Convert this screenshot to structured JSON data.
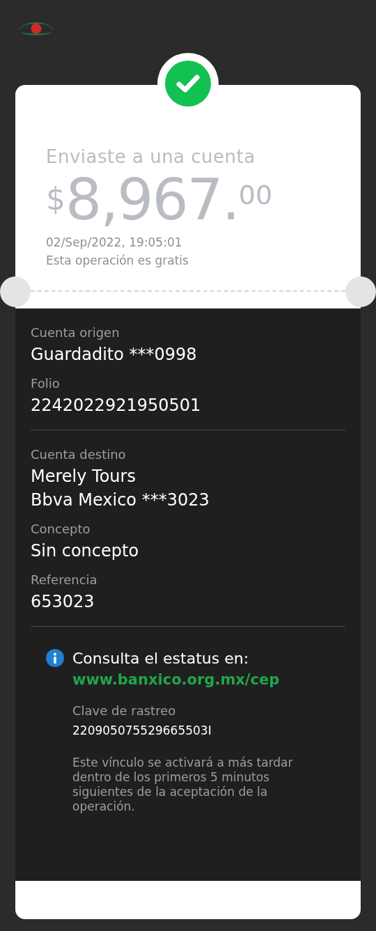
{
  "receipt": {
    "title": "Enviaste a una cuenta",
    "amount": {
      "currency": "$",
      "integer": "8,967.",
      "decimals": "00"
    },
    "datetime": "02/Sep/2022, 19:05:01",
    "fee_note": "Esta operación es gratis"
  },
  "sections": [
    {
      "fields": [
        {
          "label": "Cuenta origen",
          "values": [
            "Guardadito ***0998"
          ]
        },
        {
          "label": "Folio",
          "values": [
            "2242022921950501"
          ]
        }
      ]
    },
    {
      "fields": [
        {
          "label": "Cuenta destino",
          "values": [
            "Merely Tours",
            "Bbva Mexico ***3023"
          ]
        },
        {
          "label": "Concepto",
          "values": [
            "Sin concepto"
          ]
        },
        {
          "label": "Referencia",
          "values": [
            "653023"
          ]
        }
      ]
    }
  ],
  "info": {
    "heading": "Consulta el estatus en:",
    "link": "www.banxico.org.mx/cep",
    "tracking_label": "Clave de rastreo",
    "tracking_key": "220905075529665503I",
    "note": "Este vínculo se activará a más tardar dentro de los primeros 5 minutos siguientes de la aceptación de la operación."
  }
}
